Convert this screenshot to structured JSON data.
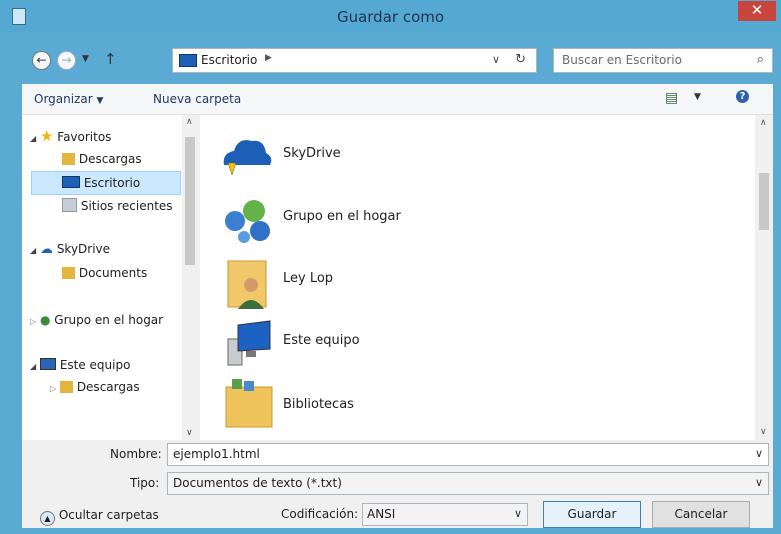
{
  "window": {
    "title": "Guardar como"
  },
  "address": {
    "location": "Escritorio",
    "search_placeholder": "Buscar en Escritorio"
  },
  "toolbar": {
    "organize": "Organizar",
    "new_folder": "Nueva carpeta"
  },
  "nav": {
    "favorites": "Favoritos",
    "downloads": "Descargas",
    "desktop": "Escritorio",
    "recent": "Sitios recientes",
    "skydrive": "SkyDrive",
    "documents": "Documents",
    "homegroup": "Grupo en el hogar",
    "this_pc": "Este equipo",
    "downloads2": "Descargas"
  },
  "items": [
    {
      "label": "SkyDrive"
    },
    {
      "label": "Grupo en el hogar"
    },
    {
      "label": "Ley Lop"
    },
    {
      "label": "Este equipo"
    },
    {
      "label": "Bibliotecas"
    }
  ],
  "form": {
    "name_label": "Nombre:",
    "name_value": "ejemplo1.html",
    "type_label": "Tipo:",
    "type_value": "Documentos de texto (*.txt)",
    "encoding_label": "Codificación:",
    "encoding_value": "ANSI"
  },
  "buttons": {
    "hide_folders": "Ocultar carpetas",
    "save": "Guardar",
    "cancel": "Cancelar"
  }
}
